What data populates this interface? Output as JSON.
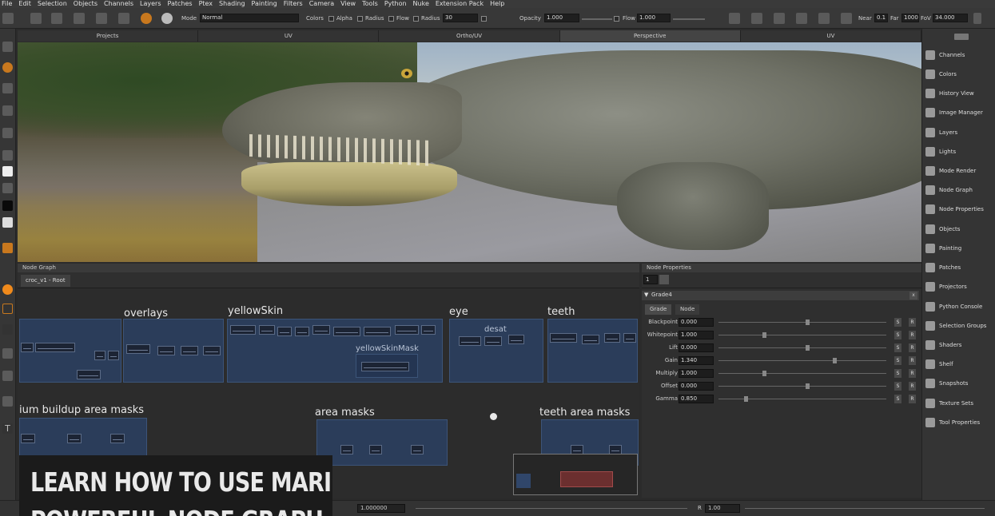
{
  "menu": [
    "File",
    "Edit",
    "Selection",
    "Objects",
    "Channels",
    "Layers",
    "Patches",
    "Ptex",
    "Shading",
    "Painting",
    "Filters",
    "Camera",
    "View",
    "Tools",
    "Python",
    "Nuke",
    "Extension Pack",
    "Help"
  ],
  "toolbar": {
    "mode_label": "Mode",
    "mode_value": "Normal",
    "colors_label": "Colors",
    "alpha_label": "Alpha",
    "radius_label": "Radius",
    "flow_label": "Flow",
    "radius2_label": "Radius",
    "radius_value": "30",
    "opacity_label": "Opacity",
    "opacity_value": "1.000",
    "flow2_label": "Flow",
    "flow_value": "1.000",
    "near_label": "Near",
    "near_value": "0.1",
    "far_label": "Far",
    "far_value": "1000",
    "fov_label": "FoV",
    "fov_value": "34.000"
  },
  "viewport_tabs": [
    "Projects",
    "UV",
    "Ortho/UV",
    "Perspective",
    "UV"
  ],
  "right_panel": [
    "Channels",
    "Colors",
    "History View",
    "Image Manager",
    "Layers",
    "Lights",
    "Mode Render",
    "Node Graph",
    "Node Properties",
    "Objects",
    "Painting",
    "Patches",
    "Projectors",
    "Python Console",
    "Selection Groups",
    "Shaders",
    "Shelf",
    "Snapshots",
    "Texture Sets",
    "Tool Properties"
  ],
  "node_graph": {
    "title": "Node Graph",
    "tab": "croc_v1 - Root",
    "backdrops": {
      "overlays": "overlays",
      "yellowskin": "yellowSkin",
      "yellowskinmask": "yellowSkinMask",
      "eye": "eye",
      "desat": "desat",
      "teeth": "teeth",
      "buildup": "ium buildup area masks",
      "area_masks": "area masks",
      "teeth_masks": "teeth area masks"
    }
  },
  "node_properties": {
    "title": "Node Properties",
    "index": "1",
    "node_name": "Grade4",
    "tabs": [
      "Grade",
      "Node"
    ],
    "params": [
      {
        "label": "Blackpoint",
        "value": "0.000",
        "knob": 0.52
      },
      {
        "label": "Whitepoint",
        "value": "1.000",
        "knob": 0.26
      },
      {
        "label": "Lift",
        "value": "0.000",
        "knob": 0.52
      },
      {
        "label": "Gain",
        "value": "1.340",
        "knob": 0.68
      },
      {
        "label": "Multiply",
        "value": "1.000",
        "knob": 0.26
      },
      {
        "label": "Offset",
        "value": "0.000",
        "knob": 0.52
      },
      {
        "label": "Gamma",
        "value": "0.850",
        "knob": 0.15
      }
    ],
    "s_label": "S",
    "r_label": "R"
  },
  "status": {
    "frame_value": "1.000000",
    "zoom_label": "R",
    "zoom_value": "1.00"
  },
  "caption": {
    "line1": "LEARN HOW TO USE MARI’S",
    "line2": "POWERFUL NODE GRAPH"
  },
  "colors": {
    "backdrop": "#2b3d5a",
    "panel": "#2f2f2f"
  }
}
